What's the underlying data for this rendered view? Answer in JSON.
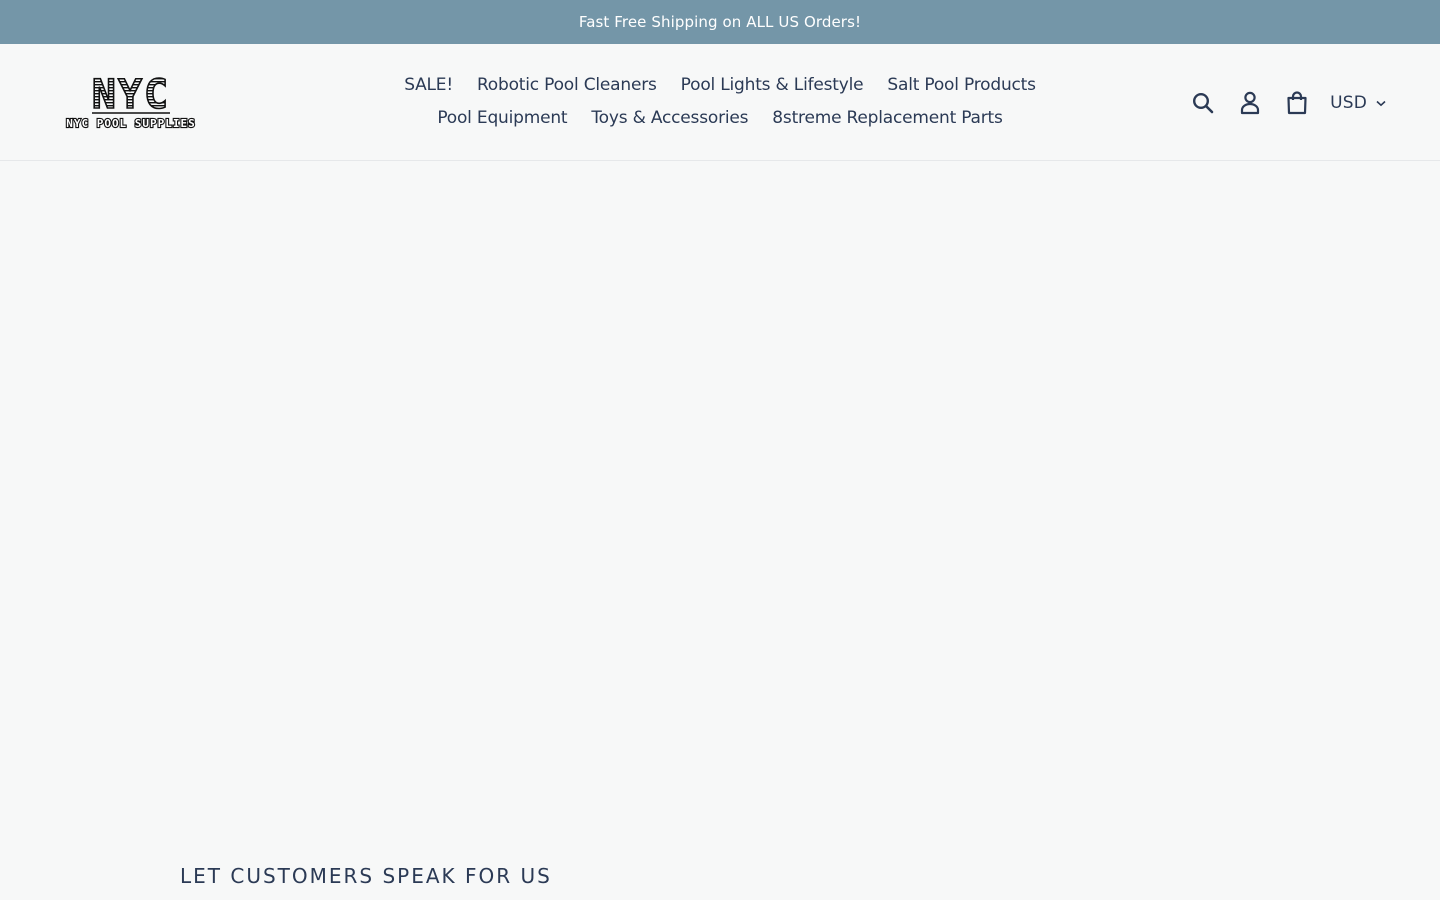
{
  "announcement": {
    "text": "Fast Free Shipping on ALL US Orders!"
  },
  "logo": {
    "big_letters": "NYC",
    "tagline": "NYC POOL SUPPLIES"
  },
  "nav": {
    "row1": [
      {
        "label": "SALE!"
      },
      {
        "label": "Robotic Pool Cleaners"
      },
      {
        "label": "Pool Lights & Lifestyle"
      },
      {
        "label": "Salt Pool Products"
      }
    ],
    "row2": [
      {
        "label": "Pool Equipment"
      },
      {
        "label": "Toys & Accessories"
      },
      {
        "label": "8streme Replacement Parts"
      }
    ]
  },
  "header_icons": {
    "search": "search-icon",
    "account": "user-icon",
    "cart": "cart-icon",
    "currency": "USD"
  },
  "section": {
    "heading": "LET CUSTOMERS SPEAK FOR US"
  },
  "colors": {
    "announcement_bg": "#7496a8",
    "text_primary": "#2b3a55",
    "page_bg": "#f7f8f8"
  }
}
